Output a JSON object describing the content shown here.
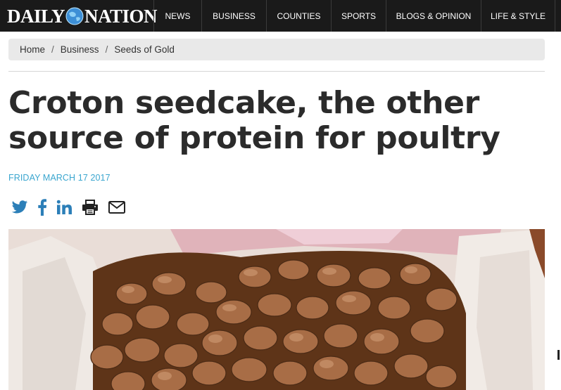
{
  "brand": {
    "logo_left": "DAILY",
    "logo_right": "NATION"
  },
  "nav": {
    "items": [
      {
        "label": "NEWS"
      },
      {
        "label": "BUSINESS"
      },
      {
        "label": "COUNTIES"
      },
      {
        "label": "SPORTS"
      },
      {
        "label": "BLOGS & OPINION"
      },
      {
        "label": "LIFE & STYLE"
      }
    ]
  },
  "breadcrumb": {
    "items": [
      "Home",
      "Business",
      "Seeds of Gold"
    ],
    "separator": "/"
  },
  "article": {
    "headline_line1": "Croton seedcake, the other",
    "headline_line2": "source of protein for poultry",
    "date": "FRIDAY MARCH 17 2017"
  },
  "share": {
    "icons": [
      "twitter-icon",
      "facebook-icon",
      "linkedin-icon",
      "print-icon",
      "email-icon"
    ]
  },
  "colors": {
    "topbar": "#1a1a1a",
    "accent_date": "#3aa6cf",
    "share_icon": "#2c7fb8",
    "breadcrumb_bg": "#e9e9e9"
  }
}
